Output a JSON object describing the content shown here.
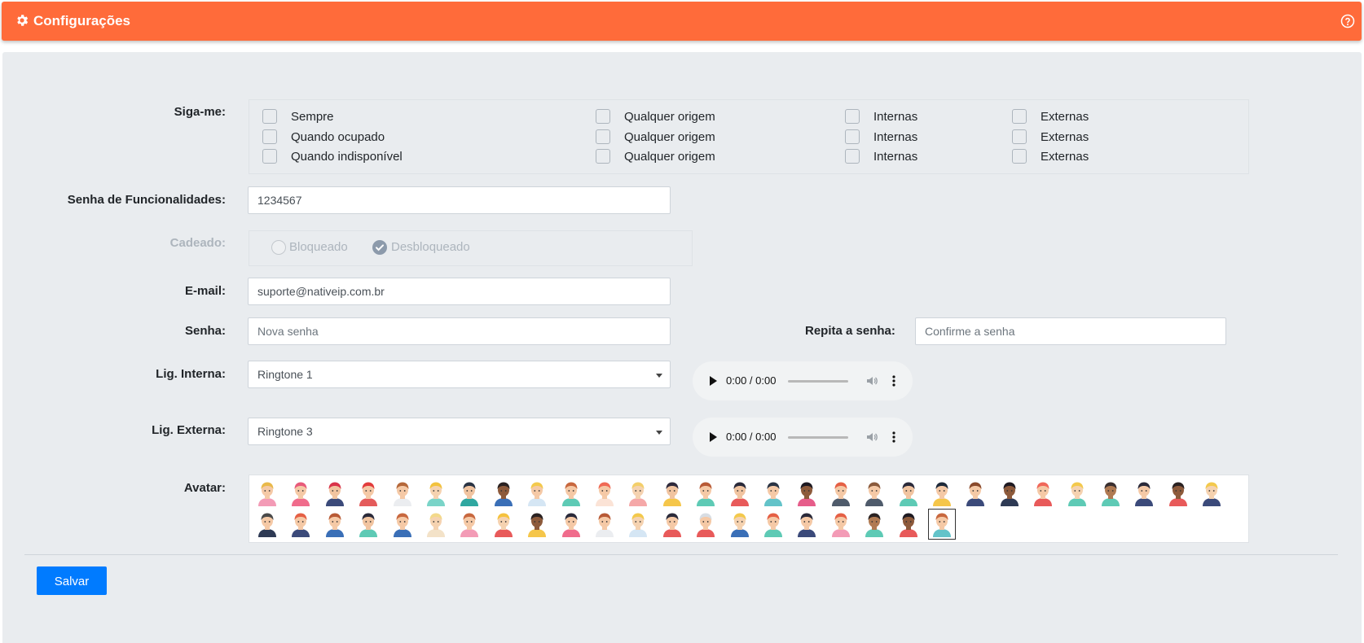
{
  "header": {
    "title": "Configurações"
  },
  "siga_me": {
    "label": "Siga-me:",
    "rows": [
      {
        "main": "Sempre",
        "origin": "Qualquer origem",
        "internal": "Internas",
        "external": "Externas"
      },
      {
        "main": "Quando ocupado",
        "origin": "Qualquer origem",
        "internal": "Internas",
        "external": "Externas"
      },
      {
        "main": "Quando indisponível",
        "origin": "Qualquer origem",
        "internal": "Internas",
        "external": "Externas"
      }
    ]
  },
  "senha_func": {
    "label": "Senha de Funcionalidades:",
    "value": "1234567"
  },
  "cadeado": {
    "label": "Cadeado:",
    "locked": "Bloqueado",
    "unlocked": "Desbloqueado",
    "selected": "Desbloqueado"
  },
  "email": {
    "label": "E-mail:",
    "value": "suporte@nativeip.com.br"
  },
  "senha": {
    "label": "Senha:",
    "placeholder": "Nova senha"
  },
  "repita": {
    "label": "Repita a senha:",
    "placeholder": "Confirme a senha"
  },
  "lig_interna": {
    "label": "Lig. Interna:",
    "value": "Ringtone 1",
    "time": "0:00 / 0:00"
  },
  "lig_externa": {
    "label": "Lig. Externa:",
    "value": "Ringtone 3",
    "time": "0:00 / 0:00"
  },
  "avatar": {
    "label": "Avatar:",
    "items": [
      {
        "skin": "#f5c9a6",
        "hair": "#e9b94a",
        "shirt": "#f39bb6"
      },
      {
        "skin": "#f5c9a6",
        "hair": "#e85a7a",
        "shirt": "#f06c8c"
      },
      {
        "skin": "#f1c4a0",
        "hair": "#d9334a",
        "shirt": "#3b4a7a"
      },
      {
        "skin": "#f5c9a6",
        "hair": "#e23c3c",
        "shirt": "#e45b5b"
      },
      {
        "skin": "#f5c9a6",
        "hair": "#b5683a",
        "shirt": "#ebedf0"
      },
      {
        "skin": "#f5d2b0",
        "hair": "#f2c23d",
        "shirt": "#7ad4c8"
      },
      {
        "skin": "#f1c4a0",
        "hair": "#2a3444",
        "shirt": "#2fa7a0"
      },
      {
        "skin": "#8d5a3b",
        "hair": "#2a2222",
        "shirt": "#3a6fb7"
      },
      {
        "skin": "#f5c9a6",
        "hair": "#f3c94c",
        "shirt": "#d5e6f4"
      },
      {
        "skin": "#f5c9a6",
        "hair": "#c8683f",
        "shirt": "#5ecab5"
      },
      {
        "skin": "#f5c9a6",
        "hair": "#f06a55",
        "shirt": "#fbe3d6"
      },
      {
        "skin": "#f5d2b0",
        "hair": "#f3cf6a",
        "shirt": "#f5a8a8"
      },
      {
        "skin": "#f1c4a0",
        "hair": "#2f2a3c",
        "shirt": "#f5c64a"
      },
      {
        "skin": "#f5c9a6",
        "hair": "#b85a36",
        "shirt": "#5ecab5"
      },
      {
        "skin": "#f1c4a0",
        "hair": "#2a2a3a",
        "shirt": "#e85a5a"
      },
      {
        "skin": "#f5c9a6",
        "hair": "#2a3444",
        "shirt": "#63c3c9"
      },
      {
        "skin": "#8d5a3b",
        "hair": "#1e1a22",
        "shirt": "#e65d8a"
      },
      {
        "skin": "#f5c9a6",
        "hair": "#e56045",
        "shirt": "#4f5b6b"
      },
      {
        "skin": "#f5c9a6",
        "hair": "#8a5a3c",
        "shirt": "#4f5b6b"
      },
      {
        "skin": "#f1c4a0",
        "hair": "#2a2a3a",
        "shirt": "#5ecab5"
      },
      {
        "skin": "#f5c9a6",
        "hair": "#1e2a3a",
        "shirt": "#f5c64a"
      },
      {
        "skin": "#f5c9a6",
        "hair": "#8a4a2c",
        "shirt": "#3b4a7a"
      },
      {
        "skin": "#8d5a3b",
        "hair": "#1e1a22",
        "shirt": "#2e3a54"
      },
      {
        "skin": "#f5c9a6",
        "hair": "#f0685a",
        "shirt": "#e85a5a"
      },
      {
        "skin": "#f5d2b0",
        "hair": "#f3c94c",
        "shirt": "#5ecab5"
      },
      {
        "skin": "#b07a52",
        "hair": "#3a3030",
        "shirt": "#5ecab5"
      },
      {
        "skin": "#f5c9a6",
        "hair": "#2a2a3a",
        "shirt": "#3b4a7a"
      },
      {
        "skin": "#8d5a3b",
        "hair": "#2a2222",
        "shirt": "#e85a5a"
      },
      {
        "skin": "#f5d2b0",
        "hair": "#f3c94c",
        "shirt": "#3b4a7a"
      },
      {
        "skin": "#f5c9a6",
        "hair": "#4a4a4a",
        "shirt": "#2e3a54"
      },
      {
        "skin": "#f5c9a6",
        "hair": "#e56045",
        "shirt": "#3b4a7a"
      },
      {
        "skin": "#f5c9a6",
        "hair": "#b85a36",
        "shirt": "#3a6fb7"
      },
      {
        "skin": "#f1c4a0",
        "hair": "#2a2a3a",
        "shirt": "#5ecab5"
      },
      {
        "skin": "#f5c9a6",
        "hair": "#c8683f",
        "shirt": "#3a6fb7"
      },
      {
        "skin": "#f5d2b0",
        "hair": "#f3d98a",
        "shirt": "#f3e2c8"
      },
      {
        "skin": "#f5c9a6",
        "hair": "#c8683f",
        "shirt": "#f39bb6"
      },
      {
        "skin": "#f5d2b0",
        "hair": "#f5c23d",
        "shirt": "#e85a5a"
      },
      {
        "skin": "#8d5a3b",
        "hair": "#2a2222",
        "shirt": "#f5c64a"
      },
      {
        "skin": "#f5c9a6",
        "hair": "#2a2a3a",
        "shirt": "#f06c8c"
      },
      {
        "skin": "#f5c9a6",
        "hair": "#b85a36",
        "shirt": "#ebedf0"
      },
      {
        "skin": "#f5d2b0",
        "hair": "#f3c94c",
        "shirt": "#d5e6f4"
      },
      {
        "skin": "#f5c9a6",
        "hair": "#2a2a3a",
        "shirt": "#e85a5a"
      },
      {
        "skin": "#f5c9a6",
        "hair": "#d8dde3",
        "shirt": "#e85a5a"
      },
      {
        "skin": "#f5d2b0",
        "hair": "#f3c94c",
        "shirt": "#3a6fb7"
      },
      {
        "skin": "#f5c9a6",
        "hair": "#e56045",
        "shirt": "#5ecab5"
      },
      {
        "skin": "#f5c9a6",
        "hair": "#2a2a3a",
        "shirt": "#3b4a7a"
      },
      {
        "skin": "#f5c9a6",
        "hair": "#e56045",
        "shirt": "#f39bb6"
      },
      {
        "skin": "#b07a52",
        "hair": "#2a2222",
        "shirt": "#5ecab5"
      },
      {
        "skin": "#8d5a3b",
        "hair": "#1e1a22",
        "shirt": "#e85a5a"
      },
      {
        "skin": "#f5c9a6",
        "hair": "#c8683f",
        "shirt": "#63c3c9"
      }
    ]
  },
  "save_label": "Salvar"
}
